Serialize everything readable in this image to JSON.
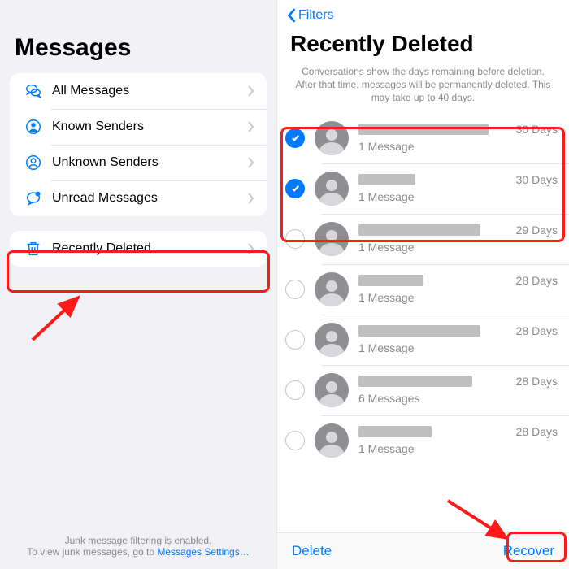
{
  "left": {
    "title": "Messages",
    "filters": [
      {
        "label": "All Messages"
      },
      {
        "label": "Known Senders"
      },
      {
        "label": "Unknown Senders"
      },
      {
        "label": "Unread Messages"
      }
    ],
    "recently_deleted_label": "Recently Deleted",
    "footer_line1": "Junk message filtering is enabled.",
    "footer_line2_prefix": "To view junk messages, go to ",
    "footer_link": "Messages Settings…"
  },
  "right": {
    "back_label": "Filters",
    "title": "Recently Deleted",
    "info": "Conversations show the days remaining before deletion. After that time, messages will be permanently deleted. This may take up to 40 days.",
    "items": [
      {
        "selected": true,
        "sub": "1 Message",
        "days": "30 Days",
        "redact_w": 160
      },
      {
        "selected": true,
        "sub": "1 Message",
        "days": "30 Days",
        "redact_w": 70
      },
      {
        "selected": false,
        "sub": "1 Message",
        "days": "29 Days",
        "redact_w": 150
      },
      {
        "selected": false,
        "sub": "1 Message",
        "days": "28 Days",
        "redact_w": 80
      },
      {
        "selected": false,
        "sub": "1 Message",
        "days": "28 Days",
        "redact_w": 150
      },
      {
        "selected": false,
        "sub": "6 Messages",
        "days": "28 Days",
        "redact_w": 140
      },
      {
        "selected": false,
        "sub": "1 Message",
        "days": "28 Days",
        "redact_w": 90
      }
    ],
    "delete_label": "Delete",
    "recover_label": "Recover"
  }
}
